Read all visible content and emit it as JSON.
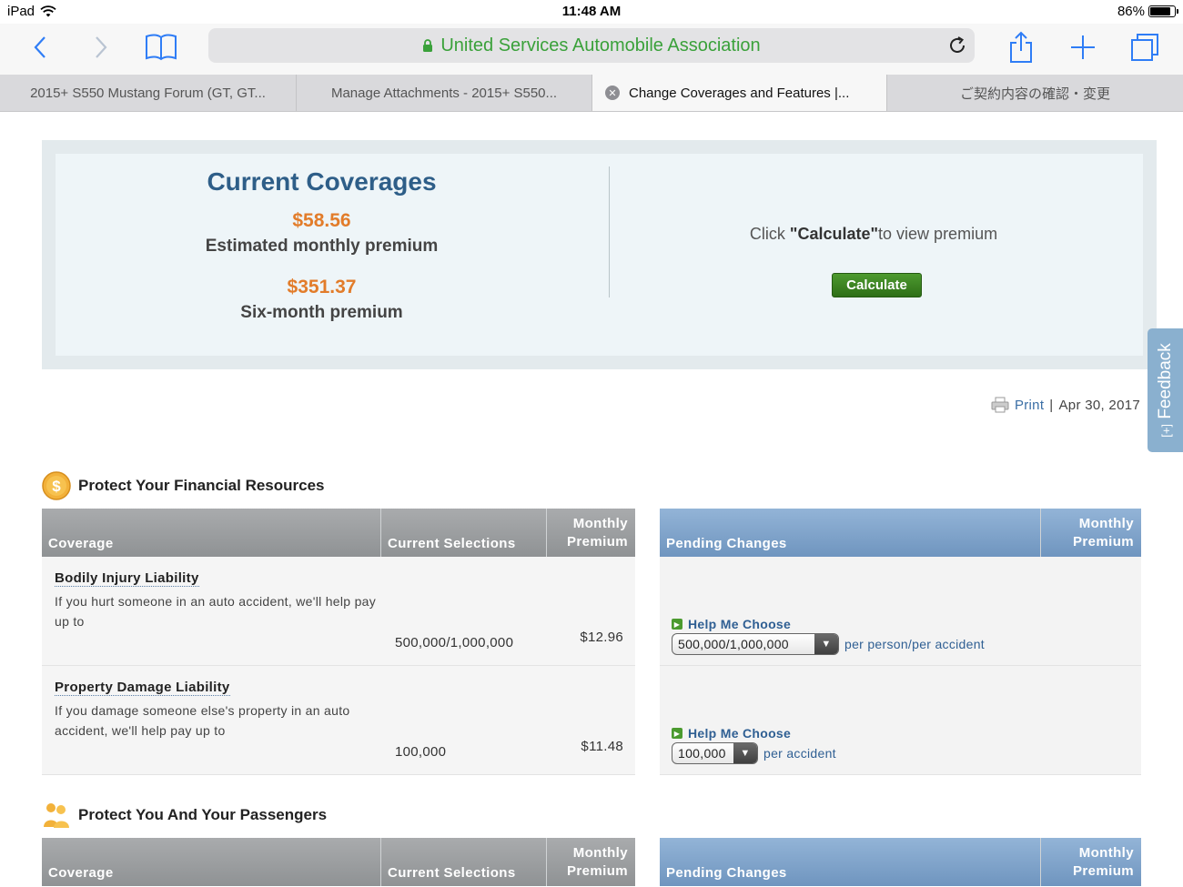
{
  "status": {
    "device": "iPad",
    "time": "11:48 AM",
    "battery": "86%",
    "battery_level": 0.86
  },
  "browser": {
    "url_text": "United Services Automobile Association",
    "tabs": [
      {
        "label": "2015+ S550 Mustang Forum (GT, GT..."
      },
      {
        "label": "Manage Attachments - 2015+ S550..."
      },
      {
        "label": "Change Coverages and Features |..."
      },
      {
        "label": "ご契約内容の確認・変更"
      }
    ]
  },
  "summary": {
    "title": "Current Coverages",
    "monthly_price": "$58.56",
    "monthly_label": "Estimated monthly premium",
    "six_month_price": "$351.37",
    "six_month_label": "Six-month premium",
    "calc_prefix": "Click ",
    "calc_bold": "\"Calculate\"",
    "calc_suffix": "to view premium",
    "calculate_button": "Calculate"
  },
  "feedback": {
    "label": "Feedback",
    "icon_text": "[+]"
  },
  "print": {
    "label": "Print",
    "separator": "|",
    "date": "Apr 30, 2017"
  },
  "sections": [
    {
      "title": "Protect Your Financial Resources",
      "headers": {
        "coverage": "Coverage",
        "current": "Current Selections",
        "monthly_line1": "Monthly",
        "monthly_line2": "Premium",
        "pending": "Pending Changes",
        "pmonthly_line1": "Monthly",
        "pmonthly_line2": "Premium"
      },
      "rows": [
        {
          "name": "Bodily Injury Liability",
          "desc": "If you hurt someone in an auto accident, we'll help pay up to",
          "current": "500,000/1,000,000",
          "premium": "$12.96",
          "help": "Help Me Choose",
          "select_value": "500,000/1,000,000",
          "unit": "per person/per accident"
        },
        {
          "name": "Property Damage Liability",
          "desc": "If you damage someone else's property in an auto accident, we'll help pay up to",
          "current": "100,000",
          "premium": "$11.48",
          "help": "Help Me Choose",
          "select_value": "100,000",
          "unit": "per accident"
        }
      ]
    },
    {
      "title": "Protect You And Your Passengers",
      "headers": {
        "coverage": "Coverage",
        "current": "Current Selections",
        "monthly_line1": "Monthly",
        "monthly_line2": "Premium",
        "pending": "Pending Changes",
        "pmonthly_line1": "Monthly",
        "pmonthly_line2": "Premium"
      }
    }
  ]
}
